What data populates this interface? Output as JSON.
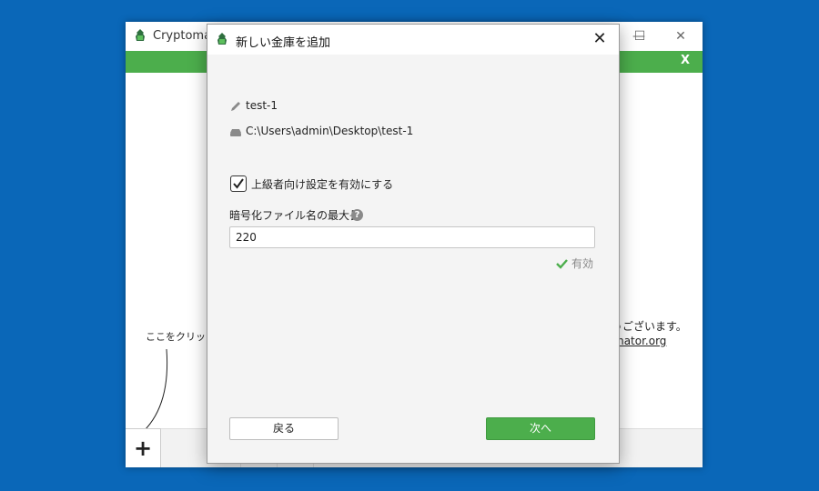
{
  "main_window": {
    "title": "Cryptomator",
    "banner_close": "X",
    "hint_text": "ここをクリックして",
    "thanks_text": "うございます。",
    "site_link": "mator.org",
    "add_button": "+",
    "controls": {
      "minimize": "—",
      "maximize": "☐",
      "close": "✕"
    }
  },
  "dialog": {
    "title": "新しい金庫を追加",
    "close": "✕",
    "vault_name": "test-1",
    "vault_path": "C:\\Users\\admin\\Desktop\\test-1",
    "advanced_checkbox_label": "上級者向け設定を有効にする",
    "advanced_checked": true,
    "max_filename_label": "暗号化ファイル名の最大長",
    "help_icon": "?",
    "max_filename_value": "220",
    "valid_text": "有効",
    "back_button": "戻る",
    "next_button": "次へ"
  },
  "colors": {
    "accent": "#4cae4c",
    "desktop": "#0a67b8"
  },
  "icons": [
    "cryptomator-logo-icon",
    "pencil-icon",
    "drive-icon",
    "checkmark-icon",
    "help-icon",
    "close-icon",
    "plus-icon"
  ]
}
